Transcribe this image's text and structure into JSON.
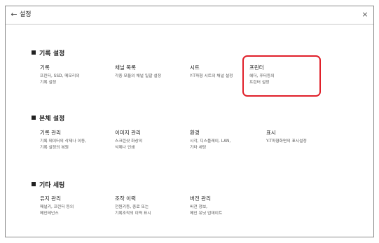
{
  "header": {
    "title": "설정",
    "back_icon": "←",
    "close_icon": "×"
  },
  "sections": [
    {
      "title": "기록 설정",
      "items": [
        {
          "label": "기록",
          "desc": [
            "프린터, SSD, 메모리의",
            "기록 설정"
          ]
        },
        {
          "label": "채널 목록",
          "desc": [
            "각종 모듈의 채널 일괄 설정"
          ]
        },
        {
          "label": "시트",
          "desc": [
            "Y-T파형 시트의 채널 설정"
          ]
        },
        {
          "label": "프린터",
          "desc": [
            "헤더, 푸터등의",
            "프린터 설정"
          ]
        }
      ]
    },
    {
      "title": "본체 설정",
      "items": [
        {
          "label": "기록 관리",
          "desc": [
            "기록 데이터의 삭제나 이동,",
            "기록 설정의 복원"
          ]
        },
        {
          "label": "이미지 관리",
          "desc": [
            "스크린샷 화상의",
            "삭제나 인쇄"
          ]
        },
        {
          "label": "환경",
          "desc": [
            "시각, 디스플레이, LAN,",
            "기타 세팅"
          ]
        },
        {
          "label": "표시",
          "desc": [
            "Y-T파형화면의 표시설정"
          ]
        }
      ]
    },
    {
      "title": "기타 세팅",
      "items": [
        {
          "label": "유지 관리",
          "desc": [
            "패널키, 프린터 등의",
            "메인테넌스"
          ]
        },
        {
          "label": "조작 이력",
          "desc": [
            "전원키등, 종료 또는",
            "기록조작의 이력 표시"
          ]
        },
        {
          "label": "버전 관리",
          "desc": [
            "버전 정보,",
            "메인 유닛 업데이트"
          ]
        }
      ]
    }
  ],
  "colors": {
    "highlight": "#e0202a",
    "border": "#8a8a8a",
    "text": "#222222"
  }
}
